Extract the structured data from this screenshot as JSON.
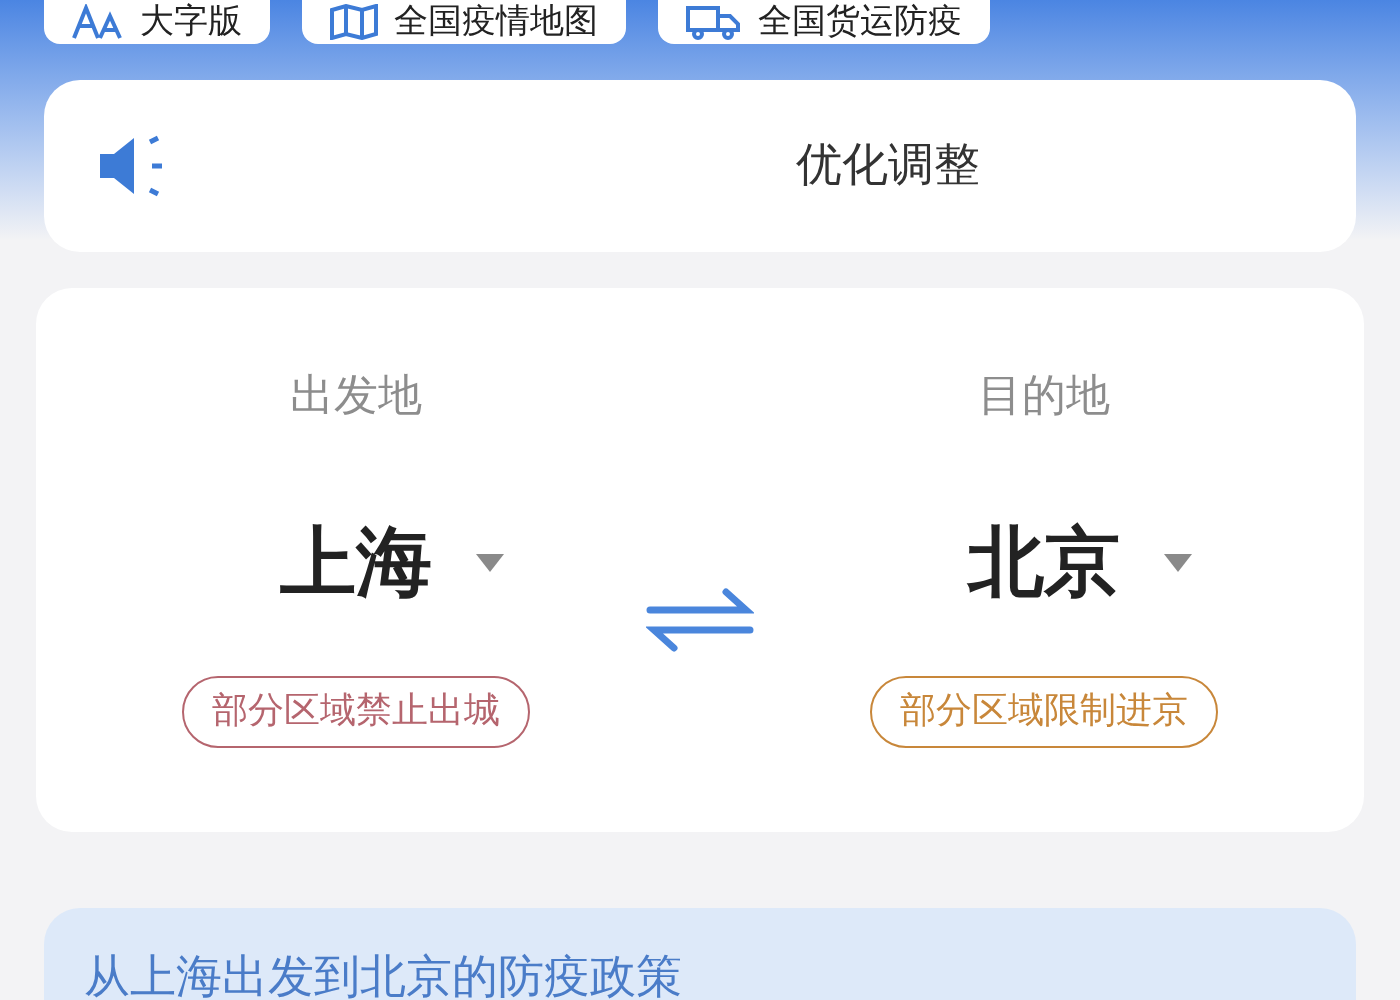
{
  "quick_links": [
    {
      "label": "大字版",
      "kind": "font"
    },
    {
      "label": "全国疫情地图",
      "kind": "map"
    },
    {
      "label": "全国货运防疫",
      "kind": "truck"
    }
  ],
  "notice": {
    "text": "优化调整"
  },
  "route": {
    "origin_label": "出发地",
    "origin": "上海",
    "origin_tag": {
      "text": "部分区域禁止出城",
      "color": "#b5656e"
    },
    "destination_label": "目的地",
    "destination": "北京",
    "destination_tag": {
      "text": "部分区域限制进京",
      "color": "#c8873a"
    }
  },
  "policy": {
    "title": "从上海出发到北京的防疫政策"
  }
}
